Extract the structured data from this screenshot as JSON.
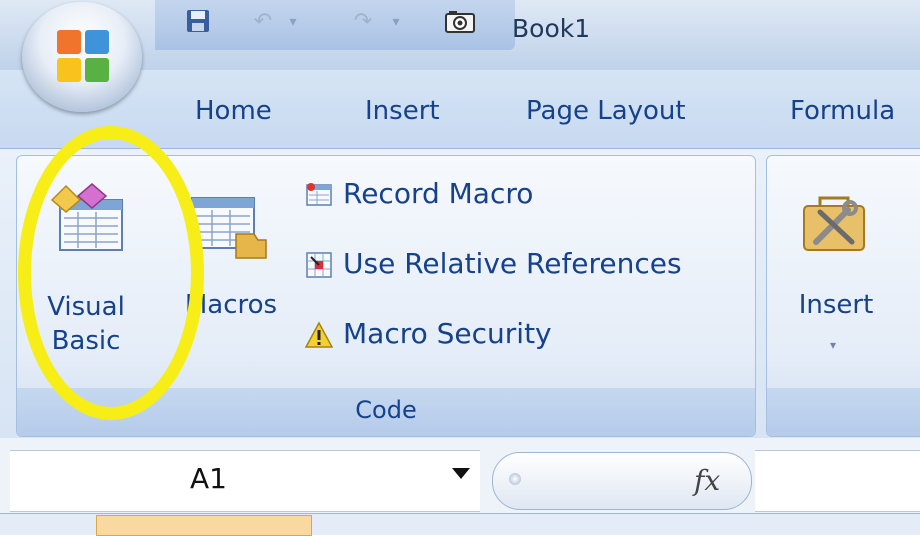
{
  "window": {
    "title": "Book1"
  },
  "quick_access": {
    "items": [
      {
        "icon": "save-icon"
      },
      {
        "icon": "undo-icon"
      },
      {
        "icon": "dropdown-icon"
      },
      {
        "icon": "redo-icon"
      },
      {
        "icon": "dropdown-icon"
      },
      {
        "icon": "camera-icon"
      }
    ]
  },
  "tabs": [
    {
      "label": "Home"
    },
    {
      "label": "Insert"
    },
    {
      "label": "Page Layout"
    },
    {
      "label": "Formula"
    }
  ],
  "ribbon": {
    "code_group": {
      "label": "Code",
      "visual_basic_label": "Visual\nBasic",
      "macros_label": "Macros",
      "record_macro_label": "Record Macro",
      "relative_refs_label": "Use Relative References",
      "macro_security_label": "Macro Security"
    },
    "controls_group": {
      "insert_label": "Insert"
    }
  },
  "formula_bar": {
    "name_box_value": "A1",
    "fx_label": "fx",
    "formula_value": ""
  },
  "colors": {
    "ribbon_text": "#15428b",
    "highlight": "#f6ee16"
  }
}
